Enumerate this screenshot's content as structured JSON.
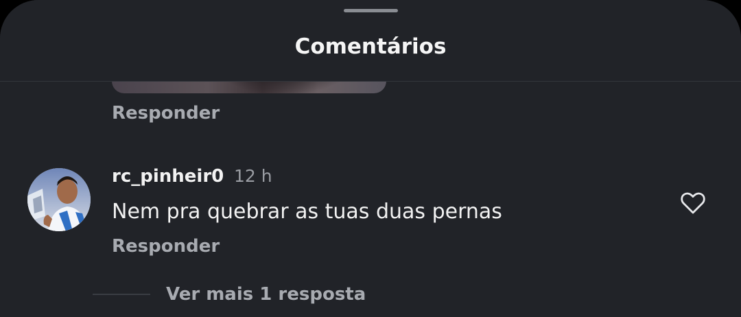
{
  "sheet": {
    "title": "Comentários"
  },
  "previous_comment": {
    "reply_label": "Responder"
  },
  "comment": {
    "username": "rc_pinheir0",
    "timestamp": "12 h",
    "text": "Nem pra quebrar as tuas duas pernas",
    "reply_label": "Responder",
    "view_replies_label": "Ver mais 1 resposta",
    "avatar_icon": "user-avatar",
    "like_icon": "heart-outline-icon"
  },
  "colors": {
    "background": "#212328",
    "primary_text": "#f2f2f2",
    "secondary_text": "#a8abb1"
  }
}
